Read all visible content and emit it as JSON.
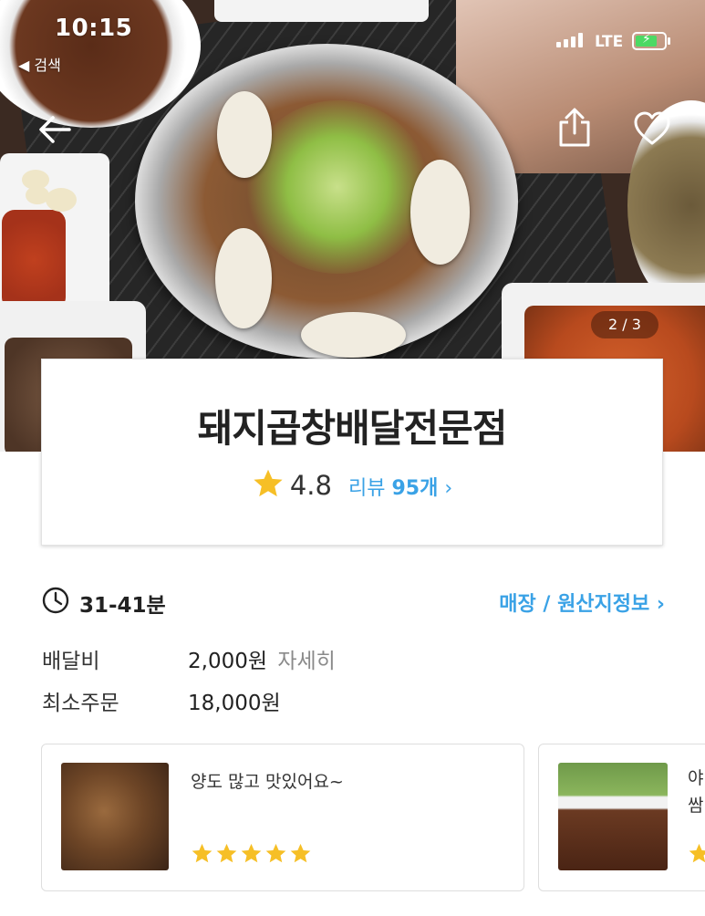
{
  "status_bar": {
    "time": "10:15",
    "back_label": "◀ 검색",
    "network": "LTE",
    "battery_level": 0.75,
    "battery_color": "#4cd964"
  },
  "hero": {
    "pager": "2 / 3",
    "icons": [
      "back-arrow-icon",
      "share-icon",
      "heart-icon"
    ]
  },
  "shop": {
    "name": "돼지곱창배달전문점",
    "rating": "4.8",
    "review_prefix": "리뷰",
    "review_count": "95개",
    "review_chevron": "›"
  },
  "delivery": {
    "time": "31-41분",
    "origin_link": "매장 / 원산지정보 ›",
    "fee_label": "배달비",
    "fee_value": "2,000원",
    "fee_detail": "자세히",
    "min_label": "최소주문",
    "min_value": "18,000원"
  },
  "reviews": [
    {
      "text": "양도 많고 맛있어요~",
      "stars": 5
    },
    {
      "text_line1": "야",
      "text_line2": "쌈"
    }
  ],
  "colors": {
    "accent": "#3aa2e6",
    "star": "#f6bf26"
  }
}
